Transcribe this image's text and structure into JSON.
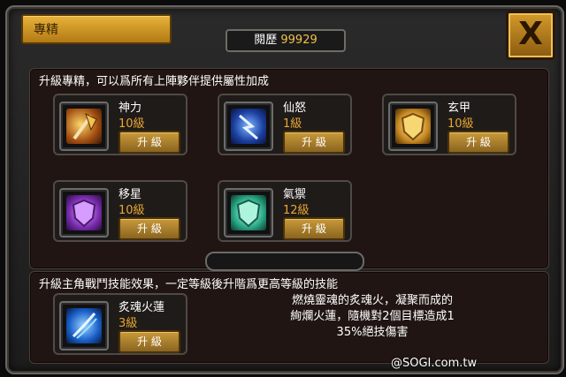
{
  "header": {
    "title": "專精",
    "history_label": "閱歷",
    "history_value": "99929",
    "close_label": "X"
  },
  "top_panel": {
    "heading": "升級專精，可以爲所有上陣夥伴提供屬性加成",
    "skills": [
      {
        "name": "神力",
        "level": "10級",
        "button": "升 級",
        "icon": "axe-icon"
      },
      {
        "name": "仙怒",
        "level": "1級",
        "button": "升 級",
        "icon": "lightning-icon"
      },
      {
        "name": "玄甲",
        "level": "10級",
        "button": "升 級",
        "icon": "gold-shield-icon"
      },
      {
        "name": "移星",
        "level": "10級",
        "button": "升 級",
        "icon": "purple-shield-icon"
      },
      {
        "name": "氣禦",
        "level": "12級",
        "button": "升 級",
        "icon": "green-shield-icon"
      }
    ]
  },
  "bottom_panel": {
    "heading": "升級主角戰鬥技能效果，一定等級後升階爲更高等級的技能",
    "skill": {
      "name": "炙魂火蓮",
      "level": "3級",
      "button": "升 級",
      "icon": "blue-slash-icon"
    },
    "description_lines": [
      "燃燒靈魂的炙魂火，凝聚而成的",
      "絢爛火蓮，隨機對2個目標造成1",
      "35%絕技傷害"
    ]
  },
  "watermark": "@SOGI.com.tw"
}
